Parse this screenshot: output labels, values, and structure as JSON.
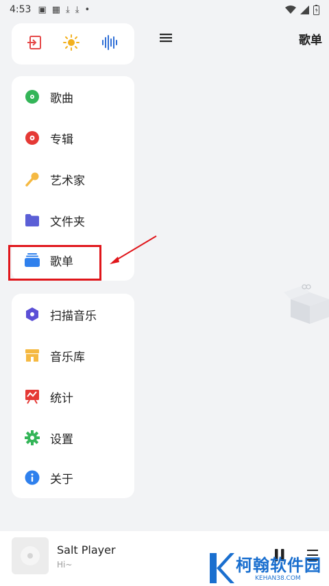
{
  "status_bar": {
    "time": "4:53",
    "icons": [
      "sim-icon",
      "grid-icon",
      "download-icon",
      "download-icon",
      "dot-icon"
    ],
    "right_icons": [
      "wifi-icon",
      "signal-icon",
      "battery-icon"
    ]
  },
  "drawer": {
    "top_actions": [
      {
        "name": "exit-icon",
        "color": "#e54848"
      },
      {
        "name": "sun-icon",
        "color": "#f2b01e"
      },
      {
        "name": "waveform-icon",
        "color": "#2f6fd6"
      }
    ],
    "nav_items": [
      {
        "label": "歌曲",
        "icon": "song-disc-icon",
        "color": "#34b558"
      },
      {
        "label": "专辑",
        "icon": "album-disc-icon",
        "color": "#e53935"
      },
      {
        "label": "艺术家",
        "icon": "microphone-icon",
        "color": "#f5b942"
      },
      {
        "label": "文件夹",
        "icon": "folder-icon",
        "color": "#5b5fd6"
      },
      {
        "label": "歌单",
        "icon": "playlist-icon",
        "color": "#2f80ed"
      }
    ],
    "tool_items": [
      {
        "label": "扫描音乐",
        "icon": "scan-icon",
        "color": "#5b4fd6"
      },
      {
        "label": "音乐库",
        "icon": "store-icon",
        "color": "#f5b942"
      },
      {
        "label": "统计",
        "icon": "stats-icon",
        "color": "#e53935"
      },
      {
        "label": "设置",
        "icon": "gear-icon",
        "color": "#34b558"
      },
      {
        "label": "关于",
        "icon": "info-icon",
        "color": "#2f80ed"
      }
    ]
  },
  "header": {
    "title": "歌单"
  },
  "player": {
    "title": "Salt Player",
    "subtitle": "Hi~"
  },
  "watermark": {
    "name": "柯翰软件园",
    "url": "KEHAN38.COM"
  }
}
